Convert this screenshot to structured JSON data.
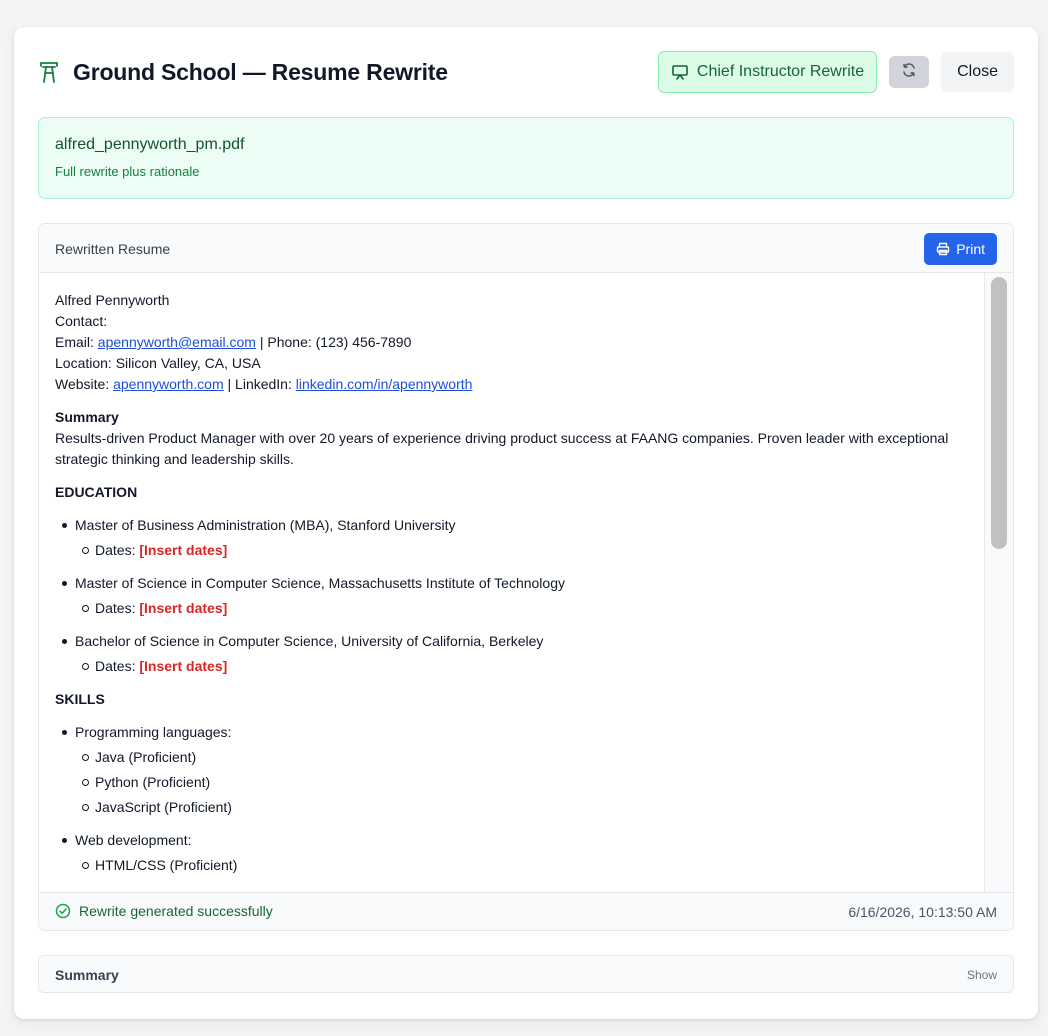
{
  "header": {
    "title": "Ground School — Resume Rewrite",
    "title_icon": "tower-icon",
    "rewrite_button": "Chief Instructor Rewrite",
    "rewrite_icon": "presentation-icon",
    "refresh_icon": "refresh-icon",
    "close_label": "Close"
  },
  "file": {
    "name": "alfred_pennyworth_pm.pdf",
    "subtitle": "Full rewrite plus rationale"
  },
  "panel": {
    "title": "Rewritten Resume",
    "print_label": "Print",
    "print_icon": "printer-icon"
  },
  "resume": {
    "name": "Alfred Pennyworth",
    "contact_label": "Contact:",
    "email_label": "Email: ",
    "email": "apennyworth@email.com",
    "phone": " | Phone: (123) 456-7890",
    "location": "Location: Silicon Valley, CA, USA",
    "website_label": "Website: ",
    "website": "apennyworth.com",
    "linkedin_label": " | LinkedIn: ",
    "linkedin": "linkedin.com/in/apennyworth",
    "summary_heading": "Summary",
    "summary_text": "Results-driven Product Manager with over 20 years of experience driving product success at FAANG companies. Proven leader with exceptional strategic thinking and leadership skills.",
    "education_heading": "EDUCATION",
    "education": [
      {
        "degree": "Master of Business Administration (MBA), Stanford University",
        "dates_label": "Dates: ",
        "dates": "[Insert dates]"
      },
      {
        "degree": "Master of Science in Computer Science, Massachusetts Institute of Technology",
        "dates_label": "Dates: ",
        "dates": "[Insert dates]"
      },
      {
        "degree": "Bachelor of Science in Computer Science, University of California, Berkeley",
        "dates_label": "Dates: ",
        "dates": "[Insert dates]"
      }
    ],
    "skills_heading": "SKILLS",
    "skills": [
      {
        "group": "Programming languages:",
        "items": [
          "Java (Proficient)",
          "Python (Proficient)",
          "JavaScript (Proficient)"
        ]
      },
      {
        "group": "Web development:",
        "items": [
          "HTML/CSS (Proficient)"
        ]
      }
    ]
  },
  "footer": {
    "status": "Rewrite generated successfully",
    "status_icon": "check-circle-icon",
    "timestamp": "6/16/2026, 10:13:50 AM"
  },
  "summary_section": {
    "title": "Summary",
    "toggle": "Show"
  },
  "colors": {
    "accent_green": "#166534",
    "print_blue": "#2563eb",
    "placeholder_red": "#dc2626",
    "link_blue": "#1d4ed8"
  }
}
